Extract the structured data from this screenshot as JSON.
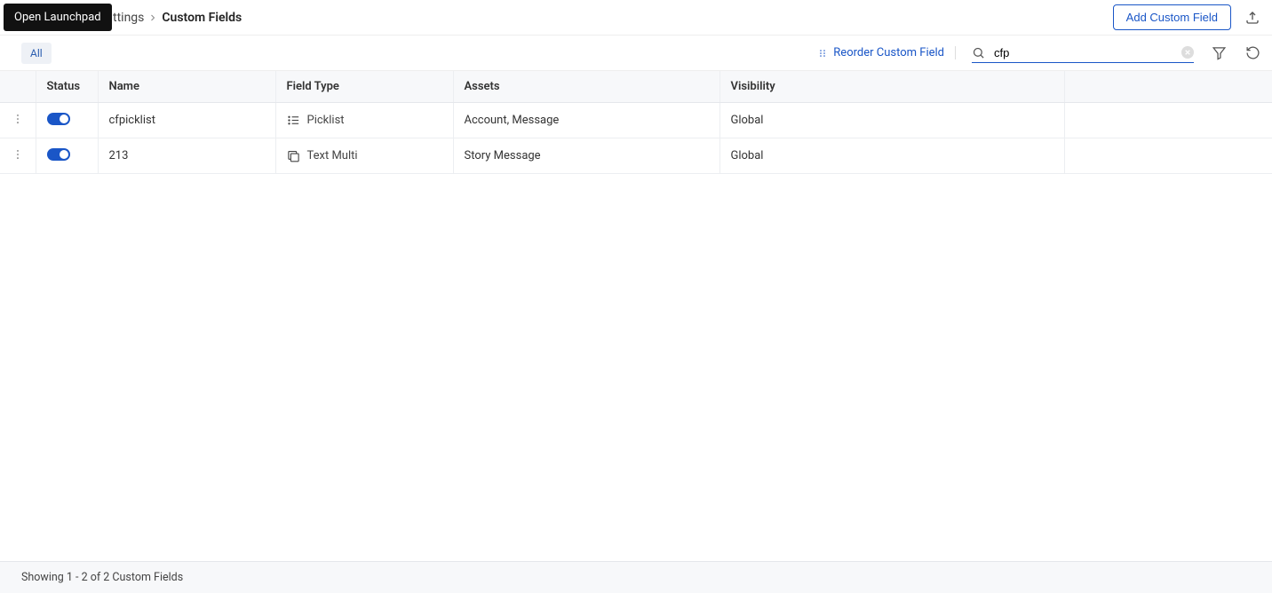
{
  "tooltip": "Open Launchpad",
  "breadcrumb": {
    "parent_partial": "ttings",
    "current": "Custom Fields"
  },
  "header": {
    "add_button": "Add Custom Field"
  },
  "toolbar": {
    "filter_all": "All",
    "reorder_label": "Reorder Custom Field"
  },
  "search": {
    "value": "cfp"
  },
  "columns": {
    "status": "Status",
    "name": "Name",
    "field_type": "Field Type",
    "assets": "Assets",
    "visibility": "Visibility"
  },
  "rows": [
    {
      "name": "cfpicklist",
      "type_label": "Picklist",
      "type_icon": "list",
      "assets": "Account, Message",
      "visibility": "Global"
    },
    {
      "name": "213",
      "type_label": "Text Multi",
      "type_icon": "textmulti",
      "assets": "Story Message",
      "visibility": "Global"
    }
  ],
  "footer": {
    "status": "Showing 1 - 2 of 2 Custom Fields"
  }
}
